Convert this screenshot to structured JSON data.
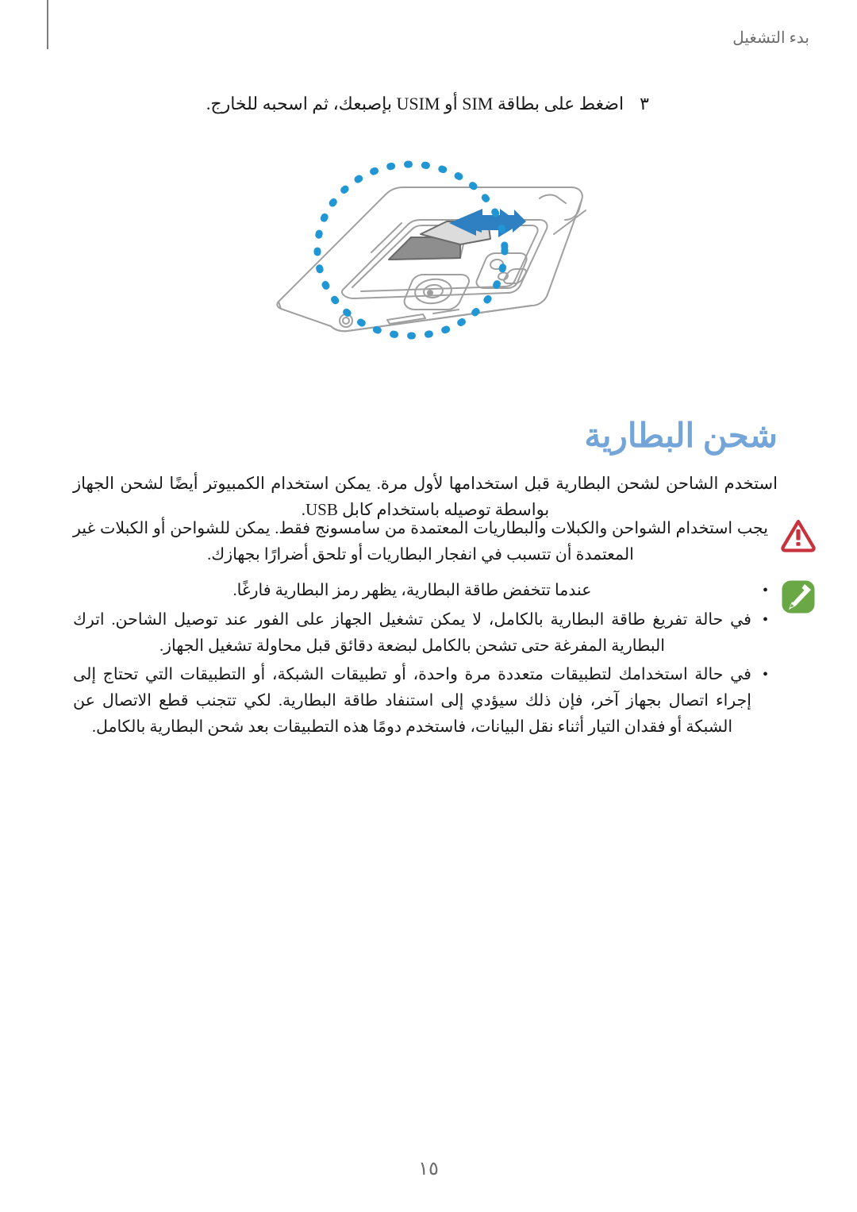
{
  "header": {
    "title": "بدء التشغيل"
  },
  "step": {
    "number": "٣",
    "text": "اضغط على بطاقة SIM أو USIM بإصبعك، ثم اسحبه للخارج."
  },
  "illustration": {
    "name": "phone-back-sim-slot-diagram",
    "highlight_color": "#2196d4",
    "arrow_color": "#2a7fc0",
    "card_color": "#8c8c8c",
    "outline_color": "#9a9a9a"
  },
  "section": {
    "heading": "شحن البطارية",
    "heading_color": "#74a5d8",
    "paragraph": "استخدم الشاحن لشحن البطارية قبل استخدامها لأول مرة. يمكن استخدام الكمبيوتر أيضًا لشحن الجهاز بواسطة توصيله باستخدام كابل USB."
  },
  "warning": {
    "icon": "warning-triangle-icon",
    "icon_color": "#c8323c",
    "text": "يجب استخدام الشواحن والكبلات والبطاريات المعتمدة من سامسونج فقط. يمكن للشواحن أو الكبلات غير المعتمدة أن تتسبب في انفجار البطاريات أو تلحق أضرارًا بجهازك."
  },
  "note": {
    "icon": "note-pencil-icon",
    "icon_color": "#6aa745",
    "bullet": "•",
    "items": [
      "عندما تتخفض طاقة البطارية، يظهر رمز البطارية فارغًا.",
      "في حالة تفريغ طاقة البطارية بالكامل، لا يمكن تشغيل الجهاز على الفور عند توصيل الشاحن. اترك البطارية المفرغة حتى تشحن بالكامل لبضعة دقائق قبل محاولة تشغيل الجهاز.",
      "في حالة استخدامك لتطبيقات متعددة مرة واحدة، أو تطبيقات الشبكة، أو التطبيقات التي تحتاج إلى إجراء اتصال بجهاز آخر، فإن ذلك سيؤدي إلى استنفاد طاقة البطارية. لكي تتجنب قطع الاتصال عن الشبكة أو فقدان التيار أثناء نقل البيانات، فاستخدم دومًا هذه التطبيقات بعد شحن البطارية بالكامل."
    ]
  },
  "footer": {
    "page_number": "١٥"
  }
}
